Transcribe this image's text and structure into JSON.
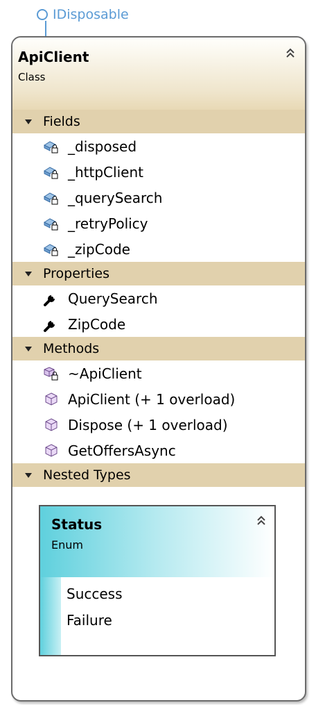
{
  "interface": {
    "name": "IDisposable"
  },
  "class": {
    "name": "ApiClient",
    "kind": "Class",
    "collapse_icon": "double-chevron-up-icon"
  },
  "sections": {
    "fields": {
      "label": "Fields",
      "items": [
        "_disposed",
        "_httpClient",
        "_querySearch",
        "_retryPolicy",
        "_zipCode"
      ]
    },
    "properties": {
      "label": "Properties",
      "items": [
        "QuerySearch",
        "ZipCode"
      ]
    },
    "methods": {
      "label": "Methods",
      "items": [
        "~ApiClient",
        "ApiClient (+ 1 overload)",
        "Dispose (+ 1 overload)",
        "GetOffersAsync"
      ]
    },
    "nested": {
      "label": "Nested Types"
    }
  },
  "nested_type": {
    "name": "Status",
    "kind": "Enum",
    "members": [
      "Success",
      "Failure"
    ]
  },
  "colors": {
    "section_bg": "#e1d1ad",
    "enum_accent": "#5fd0dd",
    "interface": "#5b9bd5"
  }
}
